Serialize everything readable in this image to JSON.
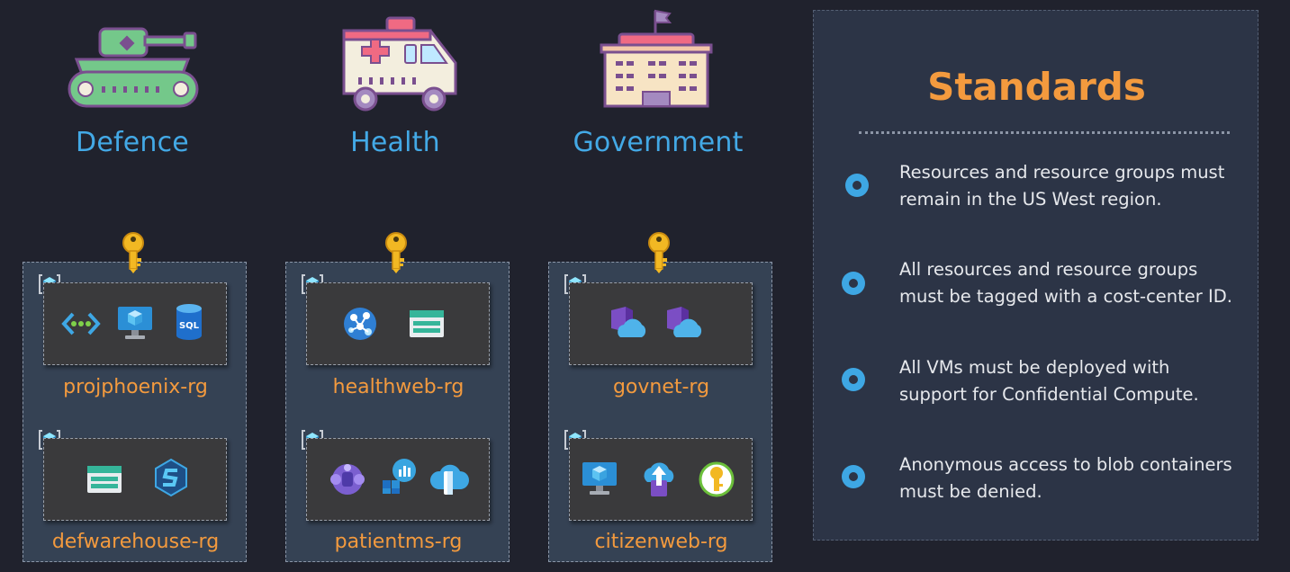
{
  "categories": [
    {
      "label": "Defence",
      "icon": "tank-icon"
    },
    {
      "label": "Health",
      "icon": "ambulance-icon"
    },
    {
      "label": "Government",
      "icon": "government-building-icon"
    }
  ],
  "subscriptions": [
    {
      "key_icon": "key-icon",
      "resource_groups": [
        {
          "label": "projphoenix-rg",
          "resources": [
            "virtual-network-icon",
            "virtual-machine-icon",
            "sql-database-icon"
          ]
        },
        {
          "label": "defwarehouse-rg",
          "resources": [
            "storage-account-icon",
            "synapse-analytics-icon"
          ]
        }
      ]
    },
    {
      "key_icon": "key-icon",
      "resource_groups": [
        {
          "label": "healthweb-rg",
          "resources": [
            "api-management-icon",
            "storage-account-icon"
          ]
        },
        {
          "label": "patientms-rg",
          "resources": [
            "teams-icon",
            "power-bi-icon",
            "api-connection-icon"
          ]
        }
      ]
    },
    {
      "key_icon": "key-icon",
      "resource_groups": [
        {
          "label": "govnet-rg",
          "resources": [
            "cloud-service-icon",
            "cloud-service-icon"
          ]
        },
        {
          "label": "citizenweb-rg",
          "resources": [
            "virtual-machine-icon",
            "upload-service-icon",
            "key-vault-icon"
          ]
        }
      ]
    }
  ],
  "standards": {
    "title": "Standards",
    "items": [
      "Resources and resource groups must remain in the US West region.",
      "All resources and resource groups must be tagged with a cost-center ID.",
      "All VMs must be deployed with support for Confidential Compute.",
      "Anonymous access to blob containers must be denied."
    ]
  },
  "colors": {
    "background": "#20222d",
    "category_text": "#43a9e6",
    "rg_label": "#f39a3e",
    "panel": "#2c3446",
    "subscription": "#354254",
    "bullet": "#3ea7e4"
  }
}
